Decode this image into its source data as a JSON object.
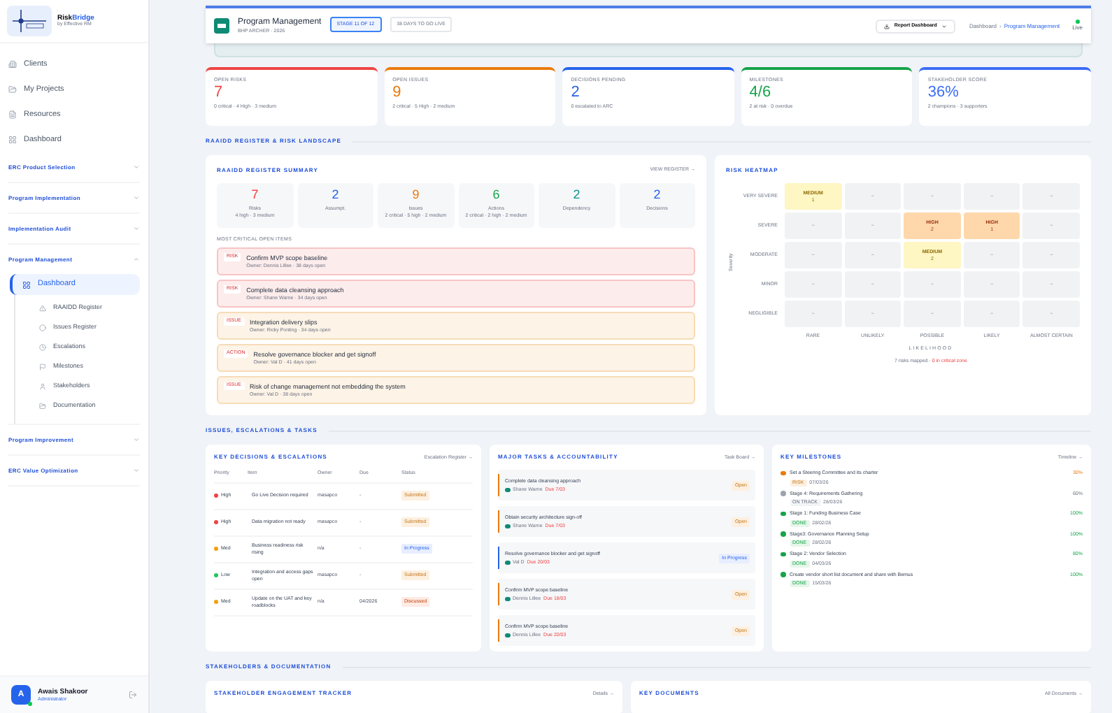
{
  "sidebar": {
    "brand_prefix": "Risk",
    "brand_suffix": "Bridge",
    "tagline": "by Effective RM",
    "nav": [
      {
        "label": "Clients"
      },
      {
        "label": "My Projects"
      },
      {
        "label": "Resources"
      },
      {
        "label": "Dashboard"
      }
    ],
    "groups": [
      {
        "label": "ERC Product Selection",
        "expanded": false
      },
      {
        "label": "Program Implementation",
        "expanded": false
      },
      {
        "label": "Implementation Audit",
        "expanded": false
      },
      {
        "label": "Program Management",
        "expanded": true,
        "children": [
          {
            "label": "Dashboard",
            "selected": true
          },
          {
            "label": "RAAIDD Register",
            "selected": false
          },
          {
            "label": "Issues Register",
            "selected": false
          },
          {
            "label": "Escalations",
            "selected": false
          },
          {
            "label": "Milestones",
            "selected": false
          },
          {
            "label": "Stakeholders",
            "selected": false
          },
          {
            "label": "Documentation",
            "selected": false
          }
        ]
      },
      {
        "label": "Program Improvement",
        "expanded": false
      },
      {
        "label": "ERC Value Optimization",
        "expanded": false
      }
    ],
    "user": {
      "initial": "A",
      "name": "Awais Shakoor",
      "role": "Administrator"
    }
  },
  "header": {
    "title": "Program Management",
    "subtitle": "BHP ARCHER · 2026",
    "badges": [
      {
        "label": "STAGE 11 OF 12",
        "selected": true
      },
      {
        "label": "38 DAYS TO GO LIVE",
        "selected": false
      }
    ],
    "report_button": "Report Dashboard",
    "breadcrumb": [
      "Dashboard",
      "›",
      "Program Management"
    ],
    "status": "Live"
  },
  "stats": [
    {
      "label": "OPEN RISKS",
      "value": "7",
      "detail": "0 critical · 4 High · 3 medium",
      "color": "#ef4444"
    },
    {
      "label": "OPEN ISSUES",
      "value": "9",
      "detail": "2 critical · 5 High · 2 medium",
      "color": "#ea7a0c"
    },
    {
      "label": "DECISIONS PENDING",
      "value": "2",
      "detail": "0 escalated to ARC",
      "color": "#2563eb"
    },
    {
      "label": "MILESTONES",
      "value": "4/6",
      "detail": "2 at risk · 0 overdue",
      "color": "#16a34a"
    },
    {
      "label": "STAKEHOLDER SCORE",
      "value": "36%",
      "detail": "2 champions · 3 supporters",
      "color": "#3b6df6"
    }
  ],
  "sections": [
    "RAAIDD REGISTER & RISK LANDSCAPE",
    "ISSUES, ESCALATIONS & TASKS",
    "STAKEHOLDERS & DOCUMENTATION"
  ],
  "raaidd": {
    "title": "RAAIDD REGISTER SUMMARY",
    "link": "VIEW REGISTER →",
    "tiles": [
      {
        "value": "7",
        "label": "Risks",
        "detail": "4 high · 3 medium",
        "color": "#ef4444"
      },
      {
        "value": "2",
        "label": "Assumpt.",
        "color": "#2563eb"
      },
      {
        "value": "9",
        "label": "Issues",
        "detail": "2 critical · 5 high · 2 medium",
        "color": "#ea7a0c"
      },
      {
        "value": "6",
        "label": "Actions",
        "detail": "2 critical · 2 high · 2 medium",
        "color": "#16a34a"
      },
      {
        "value": "2",
        "label": "Dependency",
        "color": "#0d9488"
      },
      {
        "value": "2",
        "label": "Decisions",
        "color": "#2563eb"
      }
    ],
    "critical_title": "MOST CRITICAL OPEN ITEMS",
    "items": [
      {
        "tag": "RISK",
        "title": "Confirm MVP scope baseline",
        "meta": "Owner: Dennis Lillee · 38 days open",
        "kind": "critical"
      },
      {
        "tag": "RISK",
        "title": "Complete data cleansing approach",
        "meta": "Owner: Shane Warne · 34 days open",
        "kind": "critical"
      },
      {
        "tag": "ISSUE",
        "title": "Integration delivery slips",
        "meta": "Owner: Ricky Ponting · 34 days open",
        "kind": "high"
      },
      {
        "tag": "ACTION",
        "title": "Resolve governance blocker and get signoff",
        "meta": "Owner: Val D · 41 days open",
        "kind": "high"
      },
      {
        "tag": "ISSUE",
        "title": "Risk of change management not embedding the system",
        "meta": "Owner: Val D · 38 days open",
        "kind": "high"
      }
    ]
  },
  "heatmap": {
    "title": "RISK HEATMAP",
    "y_label": "Severity",
    "x_label": "LIKELIHOOD",
    "rows": [
      "VERY SEVERE",
      "SEVERE",
      "MODERATE",
      "MINOR",
      "NEGLIGIBLE"
    ],
    "columns": [
      "RARE",
      "UNLIKELY",
      "POSSIBLE",
      "LIKELY",
      "ALMOST CERTAIN"
    ],
    "cells": [
      [
        {
          "kind": "medium",
          "label": "MEDIUM",
          "count": "1"
        },
        {
          "kind": "empty",
          "label": "–"
        },
        {
          "kind": "empty",
          "label": "–"
        },
        {
          "kind": "empty",
          "label": "–"
        },
        {
          "kind": "empty",
          "label": "–"
        }
      ],
      [
        {
          "kind": "empty",
          "label": "–"
        },
        {
          "kind": "empty",
          "label": "–"
        },
        {
          "kind": "high",
          "label": "HIGH",
          "count": "2"
        },
        {
          "kind": "high",
          "label": "HIGH",
          "count": "1"
        },
        {
          "kind": "empty",
          "label": "–"
        }
      ],
      [
        {
          "kind": "empty",
          "label": "–"
        },
        {
          "kind": "empty",
          "label": "–"
        },
        {
          "kind": "medium",
          "label": "MEDIUM",
          "count": "2"
        },
        {
          "kind": "empty",
          "label": "–"
        },
        {
          "kind": "empty",
          "label": "–"
        }
      ],
      [
        {
          "kind": "empty",
          "label": "–"
        },
        {
          "kind": "empty",
          "label": "–"
        },
        {
          "kind": "empty",
          "label": "–"
        },
        {
          "kind": "empty",
          "label": "–"
        },
        {
          "kind": "empty",
          "label": "–"
        }
      ],
      [
        {
          "kind": "empty",
          "label": "–"
        },
        {
          "kind": "empty",
          "label": "–"
        },
        {
          "kind": "empty",
          "label": "–"
        },
        {
          "kind": "empty",
          "label": "–"
        },
        {
          "kind": "empty",
          "label": "–"
        }
      ]
    ],
    "footer_a": "7 risks mapped",
    "footer_b": " · 0 in critical zone"
  },
  "escalations": {
    "title": "KEY DECISIONS & ESCALATIONS",
    "link": "Escalation Register →",
    "columns": [
      "Priority",
      "Item",
      "Owner",
      "Due",
      "Status"
    ],
    "rows": [
      {
        "priority": "High",
        "color": "#ef4444",
        "item": "Go Live Decision required",
        "owner": "masapco",
        "due": "-",
        "status": "Submitted",
        "kind": "submitted"
      },
      {
        "priority": "High",
        "color": "#ef4444",
        "item": "Data migration not ready",
        "owner": "masapco",
        "due": "-",
        "status": "Submitted",
        "kind": "submitted"
      },
      {
        "priority": "Med",
        "color": "#f59e0b",
        "item": "Business readiness risk rising",
        "owner": "n/a",
        "due": "-",
        "status": "In Progress",
        "kind": "progress"
      },
      {
        "priority": "Low",
        "color": "#22c55e",
        "item": "Integration and access gaps open",
        "owner": "masapco",
        "due": "-",
        "status": "Submitted",
        "kind": "submitted"
      },
      {
        "priority": "Med",
        "color": "#f59e0b",
        "item": "Update on the UAT and key roadblocks",
        "owner": "n/a",
        "due": "04/2026",
        "status": "Discussed",
        "kind": "discussed"
      }
    ]
  },
  "tasks": {
    "title": "MAJOR TASKS & ACCOUNTABILITY",
    "link": "Task Board →",
    "items": [
      {
        "title": "Complete data cleansing approach",
        "owner": "Shane Warne",
        "due": "Due 7/03",
        "status": "Open",
        "kind": "open"
      },
      {
        "title": "Obtain security architecture sign-off",
        "owner": "Shane Warne",
        "due": "Due 7/03",
        "status": "Open",
        "kind": "open"
      },
      {
        "title": "Resolve governance blocker and get signoff",
        "owner": "Val D",
        "due": "Due 20/03",
        "status": "In Progress",
        "kind": "progress"
      },
      {
        "title": "Confirm MVP scope baseline",
        "owner": "Dennis Lillee",
        "due": "Due 18/03",
        "status": "Open",
        "kind": "open"
      },
      {
        "title": "Confirm MVP scope baseline",
        "owner": "Dennis Lillee",
        "due": "Due 20/03",
        "status": "Open",
        "kind": "open"
      }
    ]
  },
  "milestones": {
    "title": "KEY MILESTONES",
    "link": "Timeline →",
    "items": [
      {
        "title": "Set a Steering Committee and its charter",
        "tag": "RISK",
        "date": "07/03/26",
        "percent": "30%",
        "kind": "risk",
        "color": "#ea7a0c"
      },
      {
        "title": "Stage 4: Requirements Gathering",
        "tag": "ON TRACK",
        "date": "28/03/26",
        "percent": "60%",
        "kind": "track",
        "color": "#9ca3af"
      },
      {
        "title": "Stage 1: Funding Business Case",
        "tag": "DONE",
        "date": "28/02/26",
        "percent": "100%",
        "kind": "done",
        "color": "#16a34a"
      },
      {
        "title": "Stage3: Governance Planning Setup",
        "tag": "DONE",
        "date": "28/02/26",
        "percent": "100%",
        "kind": "done",
        "color": "#16a34a"
      },
      {
        "title": "Stage 2: Vendor Selection",
        "tag": "DONE",
        "date": "04/03/26",
        "percent": "80%",
        "kind": "done",
        "color": "#16a34a"
      },
      {
        "title": "Create vendor short list document and share with Bemus",
        "tag": "DONE",
        "date": "15/03/26",
        "percent": "100%",
        "kind": "done",
        "color": "#16a34a"
      }
    ]
  },
  "stakeholder_card": {
    "title": "STAKEHOLDER ENGAGEMENT TRACKER",
    "link": "Details →"
  },
  "documents_card": {
    "title": "KEY DOCUMENTS",
    "link": "All Documents →"
  }
}
